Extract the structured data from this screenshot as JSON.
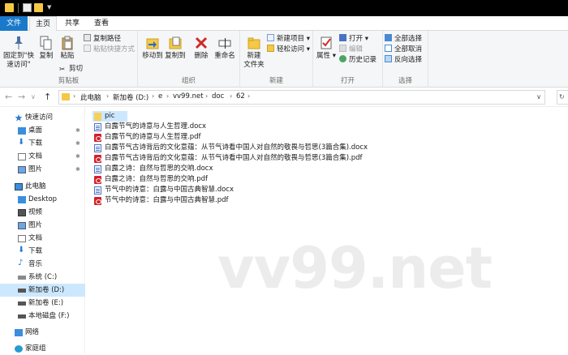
{
  "quick_toolbar": {
    "icons": [
      "folder-icon",
      "properties-icon",
      "new-folder-icon",
      "dropdown-icon"
    ]
  },
  "tabs": [
    {
      "label": "文件"
    },
    {
      "label": "主页"
    },
    {
      "label": "共享"
    },
    {
      "label": "查看"
    }
  ],
  "ribbon": {
    "clipboard": {
      "group_label": "剪贴板",
      "pin_label_1": "固定到\"快",
      "pin_label_2": "速访问\"",
      "copy_label": "复制",
      "paste_label": "粘贴",
      "copy_path_label": "复制路径",
      "paste_shortcut_label": "粘贴快捷方式",
      "cut_label": "剪切"
    },
    "organize": {
      "group_label": "组织",
      "move_to_label": "移动到",
      "copy_to_label": "复制到",
      "delete_label": "删除",
      "rename_label": "重命名"
    },
    "new": {
      "group_label": "新建",
      "new_folder_label_1": "新建",
      "new_folder_label_2": "文件夹",
      "new_item_label": "新建项目",
      "easy_access_label": "轻松访问"
    },
    "open": {
      "group_label": "打开",
      "properties_label": "属性",
      "open_label": "打开",
      "edit_label": "编辑",
      "history_label": "历史记录"
    },
    "select": {
      "group_label": "选择",
      "select_all_label": "全部选择",
      "select_none_label": "全部取消",
      "invert_label": "反向选择"
    }
  },
  "address_bar": {
    "crumbs": [
      "此电脑",
      "新加卷 (D:)",
      "e",
      "vv99.net",
      "doc",
      "62"
    ]
  },
  "nav_pane": {
    "items": [
      {
        "label": "快速访问",
        "icon": "star-icon"
      },
      {
        "label": "桌面",
        "icon": "desktop-icon",
        "pinned": true
      },
      {
        "label": "下载",
        "icon": "download-icon",
        "pinned": true
      },
      {
        "label": "文档",
        "icon": "document-icon",
        "pinned": true
      },
      {
        "label": "图片",
        "icon": "picture-icon",
        "pinned": true
      },
      {
        "label": "此电脑",
        "icon": "computer-icon"
      },
      {
        "label": "Desktop",
        "icon": "folder-icon"
      },
      {
        "label": "视频",
        "icon": "video-icon"
      },
      {
        "label": "图片",
        "icon": "picture-icon"
      },
      {
        "label": "文档",
        "icon": "document-icon"
      },
      {
        "label": "下载",
        "icon": "download-icon"
      },
      {
        "label": "音乐",
        "icon": "music-icon"
      },
      {
        "label": "系统 (C:)",
        "icon": "drive-icon"
      },
      {
        "label": "新加卷 (D:)",
        "icon": "drive-icon",
        "selected": true
      },
      {
        "label": "新加卷 (E:)",
        "icon": "drive-icon"
      },
      {
        "label": "本地磁盘 (F:)",
        "icon": "drive-icon"
      },
      {
        "label": "网络",
        "icon": "network-icon"
      },
      {
        "label": "家庭组",
        "icon": "homegroup-icon"
      }
    ]
  },
  "files": [
    {
      "name": "pic",
      "type": "folder",
      "selected": true
    },
    {
      "name": "白露节气的诗意与人生哲理.docx",
      "type": "docx"
    },
    {
      "name": "白露节气的诗意与人生哲理.pdf",
      "type": "pdf"
    },
    {
      "name": "白露节气古诗背后的文化意蕴：从节气诗看中国人对自然的敬畏与哲思(3篇合集).docx",
      "type": "docx"
    },
    {
      "name": "白露节气古诗背后的文化意蕴：从节气诗看中国人对自然的敬畏与哲思(3篇合集).pdf",
      "type": "pdf"
    },
    {
      "name": "白露之诗：自然与哲思的交响.docx",
      "type": "docx"
    },
    {
      "name": "白露之诗：自然与哲思的交响.pdf",
      "type": "pdf"
    },
    {
      "name": "节气中的诗意：白露与中国古典智慧.docx",
      "type": "docx"
    },
    {
      "name": "节气中的诗意：白露与中国古典智慧.pdf",
      "type": "pdf"
    }
  ],
  "watermark": "vv99.net",
  "colors": {
    "file_tab": "#1979ca",
    "selection": "#cce8ff",
    "pdf_red": "#d6202a",
    "folder_yellow": "#f7cf5a"
  }
}
